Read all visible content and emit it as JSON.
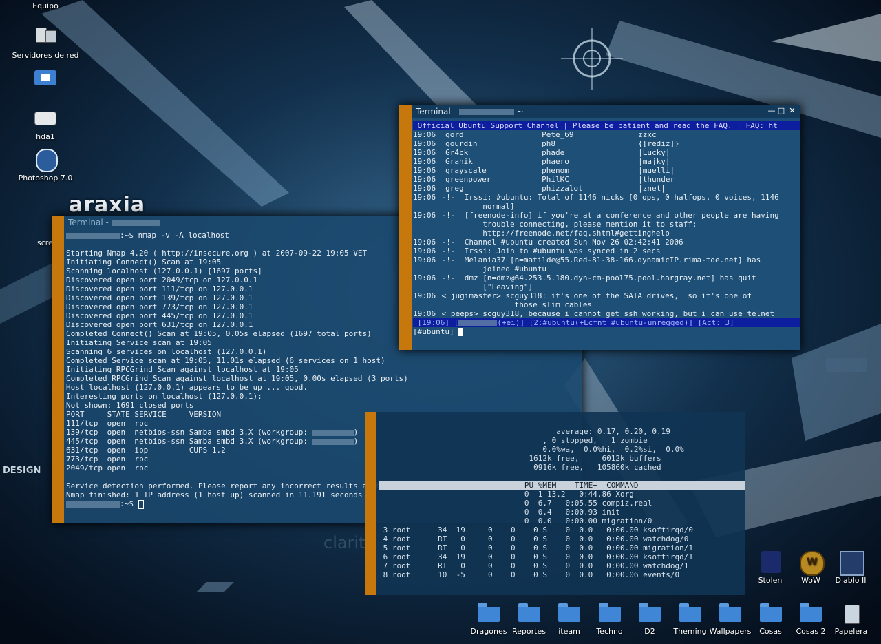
{
  "colors": {
    "accent": "#c7780c",
    "topic_bar": "#0d1f9e",
    "term_bg": "#1e4f76"
  },
  "desktop_icons_left": [
    {
      "label": "Equipo",
      "icon": "computer-icon"
    },
    {
      "label": "Servidores de red",
      "icon": "network-servers-icon"
    },
    {
      "label": "",
      "icon": "home-folder-icon"
    },
    {
      "label": "hda1",
      "icon": "hard-drive-icon"
    },
    {
      "label": "Photoshop 7.0",
      "icon": "photoshop-icon"
    },
    {
      "label": "scree",
      "icon": "screenshot-icon"
    }
  ],
  "desktop_icons_right": [
    {
      "label": "Stolen",
      "icon": "stolen-game-icon"
    },
    {
      "label": "WoW",
      "icon": "wow-icon"
    },
    {
      "label": "Diablo II",
      "icon": "diablo-icon"
    }
  ],
  "desktop_folders_bottom": [
    {
      "label": "Dragones",
      "icon": "folder-icon"
    },
    {
      "label": "Reportes",
      "icon": "folder-icon"
    },
    {
      "label": "iteam",
      "icon": "folder-icon"
    },
    {
      "label": "Techno",
      "icon": "folder-icon"
    },
    {
      "label": "D2",
      "icon": "folder-icon"
    },
    {
      "label": "Theming",
      "icon": "folder-icon"
    },
    {
      "label": "Wallpapers",
      "icon": "folder-icon"
    },
    {
      "label": "Cosas",
      "icon": "folder-icon"
    },
    {
      "label": "Cosas 2",
      "icon": "folder-icon"
    },
    {
      "label": "Papelera",
      "icon": "trash-icon"
    }
  ],
  "wallpaper": {
    "logo_text": "araxia",
    "brand": "DESIGN",
    "clarity": "clarity"
  },
  "irc_window": {
    "title": "Terminal - ",
    "title_suffix": "~",
    "topic": " Official Ubuntu Support Channel | Please be patient and read the FAQ. | FAQ: ht",
    "names": [
      {
        "time": "19:06",
        "c1": "gord",
        "c2": "Pete_69",
        "c3": "zzxc"
      },
      {
        "time": "19:06",
        "c1": "gourdin",
        "c2": "ph8",
        "c3": "{[rediz]}"
      },
      {
        "time": "19:06",
        "c1": "Gr4ck",
        "c2": "phade",
        "c3": "|Lucky|"
      },
      {
        "time": "19:06",
        "c1": "Grahik",
        "c2": "phaero",
        "c3": "|majky|"
      },
      {
        "time": "19:06",
        "c1": "grayscale",
        "c2": "phenom",
        "c3": "|muelli|"
      },
      {
        "time": "19:06",
        "c1": "greenpower",
        "c2": "PhilKC",
        "c3": "|thunder"
      },
      {
        "time": "19:06",
        "c1": "greg",
        "c2": "phizzalot",
        "c3": "|znet|"
      }
    ],
    "messages": [
      {
        "time": "19:06",
        "text": " -!-  Irssi: #ubuntu: Total of 1146 nicks [0 ops, 0 halfops, 0 voices, 1146"
      },
      {
        "time": "",
        "text": "          normal]"
      },
      {
        "time": "19:06",
        "text": " -!-  [freenode-info] if you're at a conference and other people are having"
      },
      {
        "time": "",
        "text": "          trouble connecting, please mention it to staff:"
      },
      {
        "time": "",
        "text": "          http://freenode.net/faq.shtml#gettinghelp"
      },
      {
        "time": "19:06",
        "text": " -!-  Channel #ubuntu created Sun Nov 26 02:42:41 2006"
      },
      {
        "time": "19:06",
        "text": " -!-  Irssi: Join to #ubuntu was synced in 2 secs"
      },
      {
        "time": "19:06",
        "text": " -!-  Melania37 [n=matilde@55.Red-81-38-166.dynamicIP.rima-tde.net] has"
      },
      {
        "time": "",
        "text": "          joined #ubuntu"
      },
      {
        "time": "19:06",
        "text": " -!-  dmz [n=dmz@64.253.5.180.dyn-cm-pool75.pool.hargray.net] has quit"
      },
      {
        "time": "",
        "text": "          [\"Leaving\"]"
      },
      {
        "time": "19:06",
        "text": " < jugimaster> scguy318: it's one of the SATA drives,  so it's one of"
      },
      {
        "time": "",
        "text": "                 those slim cables"
      },
      {
        "time": "19:06",
        "text": " < peeps> scguy318, because i cannot get ssh working, but i can use telnet"
      }
    ],
    "status": " [19:06] [",
    "status_rest": "(+ei)] [2:#ubuntu(+Lcfnt #ubuntu-unregged)] [Act: 3]",
    "prompt": "[#ubuntu] "
  },
  "nmap_window": {
    "title": "Terminal - ",
    "command_line": ":~$ nmap -v -A localhost",
    "output": [
      "",
      "Starting Nmap 4.20 ( http://insecure.org ) at 2007-09-22 19:05 VET",
      "Initiating Connect() Scan at 19:05",
      "Scanning localhost (127.0.0.1) [1697 ports]",
      "Discovered open port 2049/tcp on 127.0.0.1",
      "Discovered open port 111/tcp on 127.0.0.1",
      "Discovered open port 139/tcp on 127.0.0.1",
      "Discovered open port 773/tcp on 127.0.0.1",
      "Discovered open port 445/tcp on 127.0.0.1",
      "Discovered open port 631/tcp on 127.0.0.1",
      "Completed Connect() Scan at 19:05, 0.05s elapsed (1697 total ports)",
      "Initiating Service scan at 19:05",
      "Scanning 6 services on localhost (127.0.0.1)",
      "Completed Service scan at 19:05, 11.01s elapsed (6 services on 1 host)",
      "Initiating RPCGrind Scan against localhost at 19:05",
      "Completed RPCGrind Scan against localhost at 19:05, 0.00s elapsed (3 ports)",
      "Host localhost (127.0.0.1) appears to be up ... good.",
      "Interesting ports on localhost (127.0.0.1):",
      "Not shown: 1691 closed ports",
      "PORT     STATE SERVICE     VERSION",
      "111/tcp  open  rpc",
      "139/tcp  open  netbios-ssn Samba smbd 3.X (workgroup: ",
      "445/tcp  open  netbios-ssn Samba smbd 3.X (workgroup: ",
      "631/tcp  open  ipp         CUPS 1.2",
      "773/tcp  open  rpc",
      "2049/tcp open  rpc",
      "",
      "Service detection performed. Please report any incorrect results at http://insecure.org/nmap/submit/ .",
      "Nmap finished: 1 IP address (1 host up) scanned in 11.191 seconds"
    ],
    "prompt": ":~$ "
  },
  "top_window": {
    "summary": [
      "                                       average: 0.17, 0.20, 0.19",
      "                                    , 0 stopped,   1 zombie",
      "                                    0.0%wa,  0.0%hi,  0.2%si,  0.0%",
      "                                 1612k free,     6012k buffers",
      "                                  0916k free,   105860k cached"
    ],
    "header": "                                PU %MEM    TIME+  COMMAND",
    "rows": [
      "                                0  1 13.2   0:44.86 Xorg",
      "                                0  6.7   0:05.55 compiz.real",
      "                                0  0.4   0:00.93 init",
      "                                0  0.0   0:00.00 migration/0",
      " 3 root      34  19     0    0    0 S    0  0.0   0:00.00 ksoftirqd/0",
      " 4 root      RT   0     0    0    0 S    0  0.0   0:00.00 watchdog/0",
      " 5 root      RT   0     0    0    0 S    0  0.0   0:00.00 migration/1",
      " 6 root      34  19     0    0    0 S    0  0.0   0:00.00 ksoftirqd/1",
      " 7 root      RT   0     0    0    0 S    0  0.0   0:00.00 watchdog/1",
      " 8 root      10  -5     0    0    0 S    0  0.0   0:00.06 events/0"
    ]
  }
}
